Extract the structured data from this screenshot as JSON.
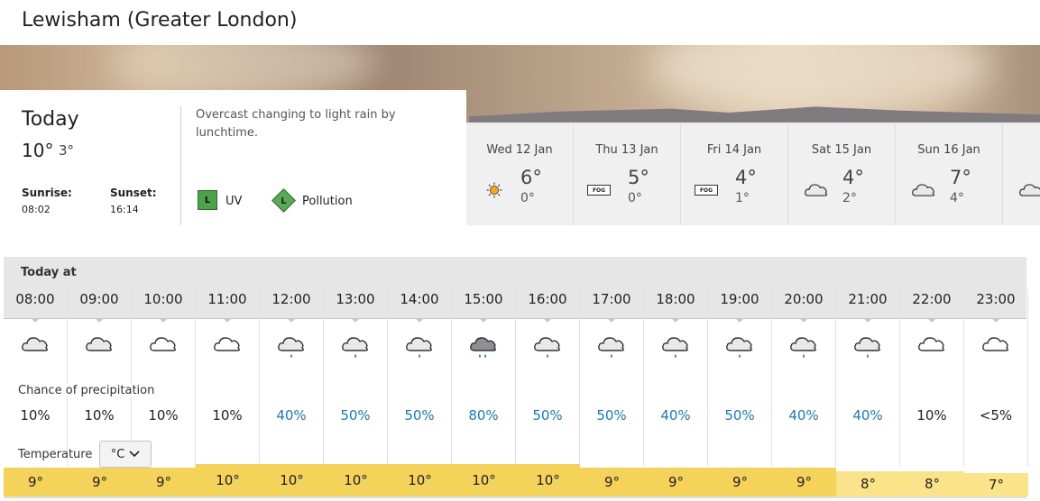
{
  "location_title": "Lewisham (Greater London)",
  "today": {
    "heading": "Today",
    "high": "10°",
    "low": "3°",
    "sunrise_label": "Sunrise:",
    "sunrise_time": "08:02",
    "sunset_label": "Sunset:",
    "sunset_time": "16:14",
    "summary": "Overcast changing to light rain by lunchtime.",
    "uv_letter": "L",
    "uv_label": "UV",
    "pollution_letter": "L",
    "pollution_label": "Pollution"
  },
  "days": [
    {
      "name": "Wed 12 Jan",
      "icon": "sunny-icon",
      "high": "6°",
      "low": "0°"
    },
    {
      "name": "Thu 13 Jan",
      "icon": "fog-icon",
      "fog_text": "FOG",
      "high": "5°",
      "low": "0°"
    },
    {
      "name": "Fri 14 Jan",
      "icon": "fog-icon",
      "fog_text": "FOG",
      "high": "4°",
      "low": "1°"
    },
    {
      "name": "Sat 15 Jan",
      "icon": "cloud-icon",
      "high": "4°",
      "low": "2°"
    },
    {
      "name": "Sun 16 Jan",
      "icon": "cloud-icon",
      "high": "7°",
      "low": "4°"
    },
    {
      "name": "Mo",
      "icon": "cloud-icon",
      "high": "",
      "low": ""
    }
  ],
  "hourly": {
    "heading": "Today at",
    "precip_label": "Chance of precipitation",
    "temp_label": "Temperature",
    "unit_button": "°C",
    "colors": {
      "rain_text": "#1f78b4",
      "temp_bar": "#f5d25a",
      "temp_bar_light": "#fbe38a"
    },
    "hours": [
      {
        "time": "08:00",
        "icon": "cloud-icon",
        "precip": "10%",
        "temp": "9°"
      },
      {
        "time": "09:00",
        "icon": "cloud-icon",
        "precip": "10%",
        "temp": "9°"
      },
      {
        "time": "10:00",
        "icon": "white-cloud-icon",
        "precip": "10%",
        "temp": "9°"
      },
      {
        "time": "11:00",
        "icon": "white-cloud-icon",
        "precip": "10%",
        "temp": "10°"
      },
      {
        "time": "12:00",
        "icon": "light-rain-icon",
        "precip": "40%",
        "temp": "10°"
      },
      {
        "time": "13:00",
        "icon": "light-rain-icon",
        "precip": "50%",
        "temp": "10°"
      },
      {
        "time": "14:00",
        "icon": "light-rain-icon",
        "precip": "50%",
        "temp": "10°"
      },
      {
        "time": "15:00",
        "icon": "heavy-rain-icon",
        "precip": "80%",
        "temp": "10°"
      },
      {
        "time": "16:00",
        "icon": "light-rain-icon",
        "precip": "50%",
        "temp": "10°"
      },
      {
        "time": "17:00",
        "icon": "light-rain-icon",
        "precip": "50%",
        "temp": "9°"
      },
      {
        "time": "18:00",
        "icon": "light-rain-icon",
        "precip": "40%",
        "temp": "9°"
      },
      {
        "time": "19:00",
        "icon": "light-rain-icon",
        "precip": "50%",
        "temp": "9°"
      },
      {
        "time": "20:00",
        "icon": "light-rain-icon",
        "precip": "40%",
        "temp": "9°"
      },
      {
        "time": "21:00",
        "icon": "light-rain-icon",
        "precip": "40%",
        "temp": "8°"
      },
      {
        "time": "22:00",
        "icon": "white-cloud-icon",
        "precip": "10%",
        "temp": "8°"
      },
      {
        "time": "23:00",
        "icon": "white-cloud-icon",
        "precip": "<5%",
        "temp": "7°"
      }
    ]
  }
}
